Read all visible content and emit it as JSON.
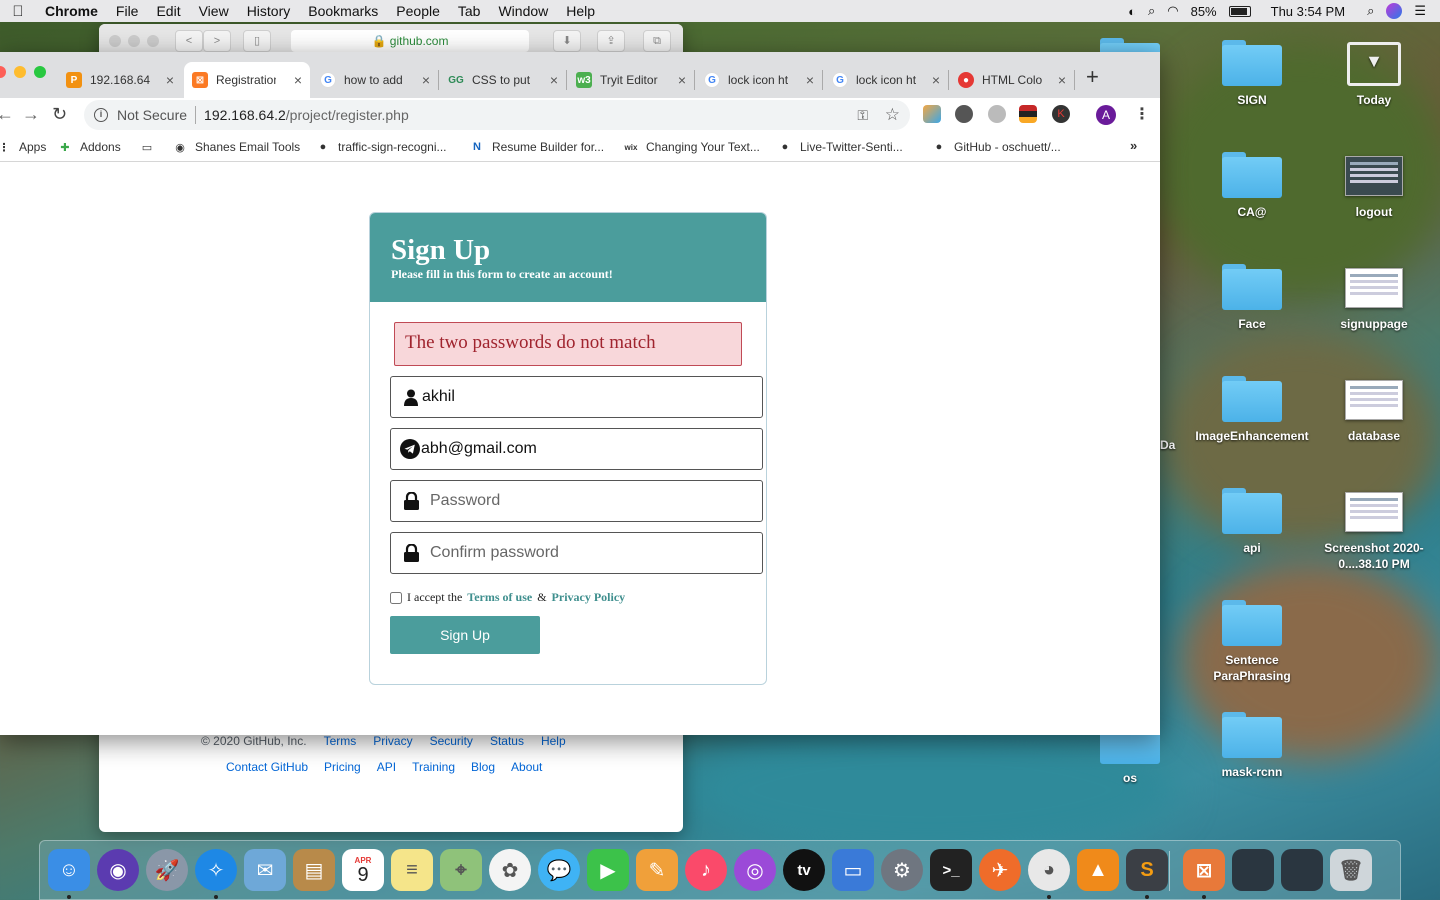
{
  "menubar": {
    "app_name": "Chrome",
    "items": [
      "File",
      "Edit",
      "View",
      "History",
      "Bookmarks",
      "People",
      "Tab",
      "Window",
      "Help"
    ],
    "battery": "85%",
    "clock": "Thu 3:54 PM"
  },
  "github_window": {
    "address": "github.com",
    "footer_row1": [
      "© 2020 GitHub, Inc.",
      "Terms",
      "Privacy",
      "Security",
      "Status",
      "Help"
    ],
    "footer_row2": [
      "Contact GitHub",
      "Pricing",
      "API",
      "Training",
      "Blog",
      "About"
    ]
  },
  "desktop_icons": [
    {
      "label": "SIGN",
      "kind": "folder"
    },
    {
      "label": "Today",
      "kind": "today"
    },
    {
      "label": "CA@",
      "kind": "folder"
    },
    {
      "label": "logout",
      "kind": "thumb"
    },
    {
      "label": "Face",
      "kind": "folder"
    },
    {
      "label": "signuppage",
      "kind": "thumb"
    },
    {
      "label": "ImageEnhancement",
      "kind": "folder"
    },
    {
      "label": "database",
      "kind": "thumb"
    },
    {
      "label": "api",
      "kind": "folder"
    },
    {
      "label": "Screenshot 2020-0....38.10 PM",
      "kind": "thumb"
    },
    {
      "label": "Sentence ParaPhrasing",
      "kind": "folder"
    },
    {
      "label": "mask-rcnn",
      "kind": "folder"
    },
    {
      "label": "os",
      "kind": "folder"
    },
    {
      "label": "Da",
      "kind": "partial"
    }
  ],
  "tabs": [
    {
      "label": "192.168.64.",
      "favicon": "phpmyadmin-icon",
      "color": "#f29111",
      "active": false
    },
    {
      "label": "Registration",
      "favicon": "xampp-icon",
      "color": "#fb7a24",
      "active": true
    },
    {
      "label": "how to add",
      "favicon": "google-icon",
      "color": "#4285f4",
      "active": false
    },
    {
      "label": "CSS to put",
      "favicon": "css-icon",
      "color": "#2e8b57",
      "active": false
    },
    {
      "label": "Tryit Editor",
      "favicon": "w3schools-icon",
      "color": "#4caf50",
      "active": false
    },
    {
      "label": "lock icon ht",
      "favicon": "google-icon",
      "color": "#4285f4",
      "active": false
    },
    {
      "label": "lock icon ht",
      "favicon": "google-icon",
      "color": "#4285f4",
      "active": false
    },
    {
      "label": "HTML Color",
      "favicon": "html-color-icon",
      "color": "#e53935",
      "active": false
    }
  ],
  "omnibox": {
    "security": "Not Secure",
    "host": "192.168.64.2",
    "path": "/project/register.php"
  },
  "bookmarks": [
    {
      "label": "Apps",
      "icon": "apps-grid-icon"
    },
    {
      "label": "Addons",
      "icon": "puzzle-icon"
    },
    {
      "label": "",
      "icon": "folder-icon"
    },
    {
      "label": "Shanes Email Tools",
      "icon": "globe-icon"
    },
    {
      "label": "traffic-sign-recogni...",
      "icon": "github-icon"
    },
    {
      "label": "Resume Builder for...",
      "icon": "novoresume-icon"
    },
    {
      "label": "Changing Your Text...",
      "icon": "wix-icon"
    },
    {
      "label": "Live-Twitter-Senti...",
      "icon": "github-icon"
    },
    {
      "label": "GitHub - oschuett/...",
      "icon": "github-icon"
    }
  ],
  "signup": {
    "title": "Sign Up",
    "subtitle": "Please fill in this form to create an account!",
    "error": "The two passwords do not match",
    "username_value": "akhil",
    "email_value": "abh@gmail.com",
    "password_placeholder": "Password",
    "confirm_placeholder": "Confirm password",
    "terms_prefix": "I accept the",
    "terms_link": "Terms of use",
    "terms_amp": "&",
    "privacy_link": "Privacy Policy",
    "button": "Sign Up",
    "accent": "#4b9d9c"
  },
  "dock_apps": [
    {
      "name": "finder-icon",
      "color": "#3a8ee6"
    },
    {
      "name": "siri-icon",
      "color": "#5b3bb0"
    },
    {
      "name": "launchpad-icon",
      "color": "#8a97a8"
    },
    {
      "name": "safari-icon",
      "color": "#1e88e5"
    },
    {
      "name": "mail-icon",
      "color": "#6ea8d8"
    },
    {
      "name": "contacts-icon",
      "color": "#b88a4a"
    },
    {
      "name": "calendar-icon",
      "color": "#ffffff"
    },
    {
      "name": "notes-icon",
      "color": "#f5e58a"
    },
    {
      "name": "maps-icon",
      "color": "#8fc27a"
    },
    {
      "name": "photos-icon",
      "color": "#f4f4f4"
    },
    {
      "name": "messages-icon",
      "color": "#3fb3f5"
    },
    {
      "name": "facetime-icon",
      "color": "#3cc24a"
    },
    {
      "name": "pages-icon",
      "color": "#f0a03a"
    },
    {
      "name": "music-icon",
      "color": "#fa4a6a"
    },
    {
      "name": "podcasts-icon",
      "color": "#9b4ad8"
    },
    {
      "name": "tv-icon",
      "color": "#111111"
    },
    {
      "name": "keynote-icon",
      "color": "#3a7ad8"
    },
    {
      "name": "system-preferences-icon",
      "color": "#6f7680"
    },
    {
      "name": "terminal-icon",
      "color": "#222222"
    },
    {
      "name": "postman-icon",
      "color": "#ef6c2a"
    },
    {
      "name": "chrome-icon",
      "color": "#e8e8e8"
    },
    {
      "name": "vlc-icon",
      "color": "#f08a1a"
    },
    {
      "name": "sublime-icon",
      "color": "#3b3f45"
    },
    {
      "name": "xampp-icon",
      "color": "#e8793a"
    },
    {
      "name": "window-thumb-icon",
      "color": "#2a3640"
    },
    {
      "name": "window-thumb-icon",
      "color": "#2a3640"
    },
    {
      "name": "trash-icon",
      "color": "#cfd6da"
    }
  ],
  "calendar_badge": {
    "month": "APR",
    "day": "9"
  }
}
